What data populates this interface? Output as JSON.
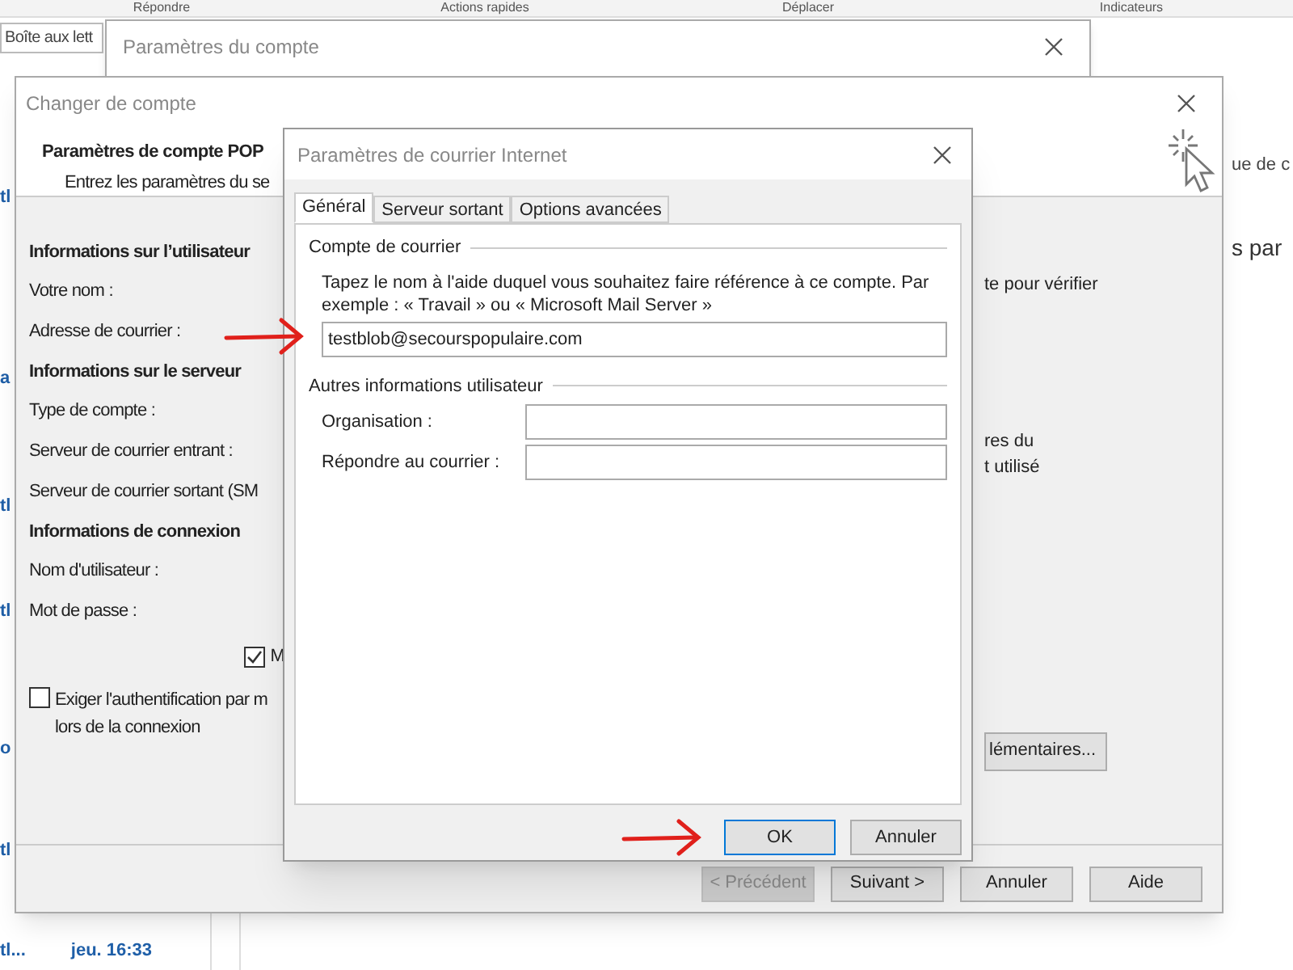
{
  "outlook": {
    "ribbon_groups": [
      "Répondre",
      "Actions rapides",
      "Déplacer",
      "Indicateurs"
    ],
    "search": {
      "placeholder": "Boîte aux lett"
    },
    "list_fragments": [
      "tl",
      "a",
      "tl",
      "tl",
      "o",
      "tl"
    ],
    "last_item": {
      "sender": "tl...",
      "time": "jeu. 16:33"
    },
    "reading_fragments": [
      "ue de c",
      "s par"
    ]
  },
  "account_settings_window": {
    "title": "Paramètres du compte"
  },
  "change_account_window": {
    "title": "Changer de compte",
    "heading": "Paramètres de compte POP",
    "subheading": "Entrez les paramètres du se",
    "sections": [
      {
        "title": "Informations sur l’utilisateur",
        "fields": [
          "Votre nom :",
          "Adresse de courrier :"
        ]
      },
      {
        "title": "Informations sur le serveur",
        "fields": [
          "Type de compte :",
          "Serveur de courrier entrant :",
          "Serveur de courrier sortant (SM"
        ]
      },
      {
        "title": "Informations de connexion",
        "fields": [
          "Nom d'utilisateur :",
          "Mot de passe :"
        ]
      }
    ],
    "remember_password": {
      "label": "M",
      "checked": true
    },
    "require_spa": {
      "lines": [
        "Exiger l'authentification par m",
        "lors de la connexion"
      ],
      "checked": false
    },
    "right_texts": [
      "te pour vérifier",
      "res du",
      "t utilisé"
    ],
    "more_settings_button": "lémentaires...",
    "buttons": [
      {
        "label": "< Précédent",
        "disabled": true
      },
      {
        "label": "Suivant >",
        "disabled": false
      },
      {
        "label": "Annuler",
        "disabled": false
      },
      {
        "label": "Aide",
        "disabled": false
      }
    ]
  },
  "internet_mail_dialog": {
    "title": "Paramètres de courrier Internet",
    "tabs": [
      {
        "label": "Général",
        "selected": true
      },
      {
        "label": "Serveur sortant",
        "selected": false
      },
      {
        "label": "Options avancées",
        "selected": false
      }
    ],
    "account_group": {
      "title": "Compte de courrier",
      "description": "Tapez le nom à l'aide duquel vous souhaitez faire référence à ce compte. Par exemple : « Travail » ou « Microsoft Mail Server »",
      "value": "testblob@secourspopulaire.com"
    },
    "other_group": {
      "title": "Autres informations utilisateur",
      "fields": [
        {
          "label": "Organisation :"
        },
        {
          "label": "Répondre au courrier :"
        }
      ]
    },
    "buttons": [
      {
        "label": "OK",
        "default": true
      },
      {
        "label": "Annuler",
        "default": false
      }
    ]
  }
}
